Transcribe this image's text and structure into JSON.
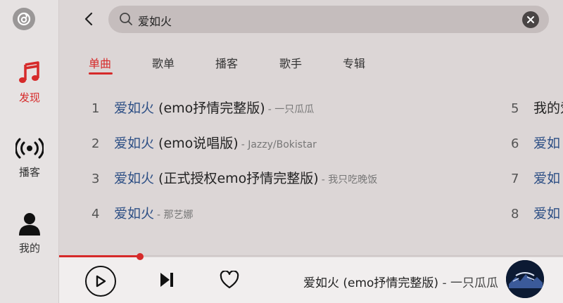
{
  "sidebar": {
    "items": [
      {
        "label": "发现",
        "icon": "music-note-icon",
        "active": true
      },
      {
        "label": "播客",
        "icon": "broadcast-icon",
        "active": false
      },
      {
        "label": "我的",
        "icon": "user-icon",
        "active": false
      }
    ]
  },
  "search": {
    "value": "爱如火"
  },
  "tabs": [
    "单曲",
    "歌单",
    "播客",
    "歌手",
    "专辑"
  ],
  "results": [
    {
      "num": "1",
      "title_hl": "爱如火",
      "title_rest": " (emo抒情完整版)",
      "artist": "- 一只瓜瓜"
    },
    {
      "num": "2",
      "title_hl": "爱如火",
      "title_rest": " (emo说唱版)",
      "artist": "- Jazzy/Bokistar"
    },
    {
      "num": "3",
      "title_hl": "爱如火",
      "title_rest": " (正式授权emo抒情完整版)",
      "artist": "- 我只吃晚饭"
    },
    {
      "num": "4",
      "title_hl": "爱如火",
      "title_rest": "",
      "artist": "- 那艺娜"
    },
    {
      "num": "5",
      "title_hl": "",
      "title_rest": "我的爱",
      "artist": ""
    },
    {
      "num": "6",
      "title_hl": "爱如",
      "title_rest": "",
      "artist": ""
    },
    {
      "num": "7",
      "title_hl": "爱如",
      "title_rest": "",
      "artist": ""
    },
    {
      "num": "8",
      "title_hl": "爱如",
      "title_rest": "",
      "artist": ""
    }
  ],
  "player": {
    "title": "爱如火 (emo抒情完整版)",
    "artist": " - 一只瓜瓜",
    "progress": 0.16
  },
  "colors": {
    "accent": "#d62a2a",
    "highlight": "#2d4f85"
  }
}
